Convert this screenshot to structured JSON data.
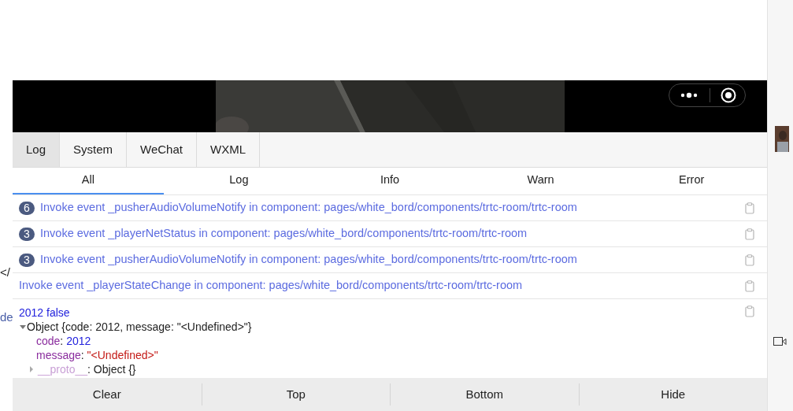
{
  "background": {
    "texts": [
      "</",
      "de"
    ]
  },
  "tabs": [
    {
      "label": "Log",
      "selected": true
    },
    {
      "label": "System",
      "selected": false
    },
    {
      "label": "WeChat",
      "selected": false
    },
    {
      "label": "WXML",
      "selected": false
    }
  ],
  "filters": [
    {
      "label": "All",
      "selected": true
    },
    {
      "label": "Log",
      "selected": false
    },
    {
      "label": "Info",
      "selected": false
    },
    {
      "label": "Warn",
      "selected": false
    },
    {
      "label": "Error",
      "selected": false
    }
  ],
  "entries": [
    {
      "kind": "event",
      "count": "6",
      "text": "Invoke event _pusherAudioVolumeNotify in component: pages/white_bord/components/trtc-room/trtc-room"
    },
    {
      "kind": "event",
      "count": "3",
      "text": "Invoke event _playerNetStatus in component: pages/white_bord/components/trtc-room/trtc-room"
    },
    {
      "kind": "event",
      "count": "3",
      "text": "Invoke event _pusherAudioVolumeNotify in component: pages/white_bord/components/trtc-room/trtc-room"
    },
    {
      "kind": "event",
      "text": "Invoke event _playerStateChange in component: pages/white_bord/components/trtc-room/trtc-room"
    },
    {
      "kind": "object",
      "head": "2012 false",
      "summary": "Object {code: 2012, message: \"<Undefined>\"}",
      "expanded": true,
      "props": [
        {
          "key": "code",
          "separator": ":",
          "value": "2012",
          "kind": "number"
        },
        {
          "key": "message",
          "separator": ":",
          "value": "\"<Undefined>\"",
          "kind": "string"
        }
      ],
      "proto": {
        "key": "__proto__",
        "separator": ":",
        "value": "Object {}",
        "expanded": false
      }
    }
  ],
  "buttons": [
    "Clear",
    "Top",
    "Bottom",
    "Hide"
  ]
}
